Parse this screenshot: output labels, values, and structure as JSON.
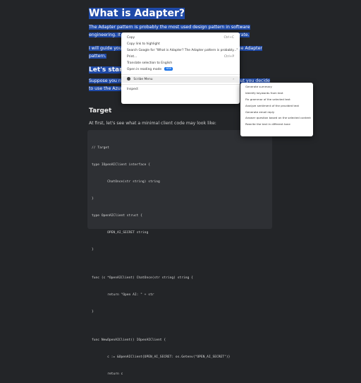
{
  "article": {
    "title": "What is Adapter?",
    "para1": "The Adapter pattern is probably the most used design pattern in software engineering. It allows objects with incompatible interfaces to collaborate.",
    "para2": "I will guide you through the example so you can better understand the Adapter pattern.",
    "heading_start": "Let's start",
    "para3": "Suppose you need to call the OpenAI client, passing the secret key. But you decide to use the Azure OpenAI client instead. How can we achieve it?",
    "heading_target": "Target",
    "para4": "At first, let's see what a minimal client code may look like:"
  },
  "code_block": {
    "lines": [
      "// Target",
      "type IOpenAIClient interface {",
      "        ChatOnce(str string) string",
      "}",
      "type OpenAIClient struct {",
      "        OPEN_AI_SECRET string",
      "}",
      "",
      "func (c *OpenAIClient) ChatOnce(str string) string {",
      "        return \"Open AI: \" + str",
      "}",
      "",
      "func NewOpenAIClient() IOpenAIClient {",
      "        c := &OpenAIClient{OPEN_AI_SECRET: os.Getenv(\"OPEN_AI_SECRET\")}",
      "        return c"
    ]
  },
  "context_menu": {
    "copy": {
      "label": "Copy",
      "shortcut": "Ctrl+C"
    },
    "copy_link": {
      "label": "Copy link to highlight"
    },
    "search_google": {
      "label": "Search Google for \"What is Adapter? The Adapter pattern is probably...\""
    },
    "print": {
      "label": "Print...",
      "shortcut": "Ctrl+P"
    },
    "translate": {
      "label": "Translate selection to English"
    },
    "reading_mode": {
      "label": "Open in reading mode",
      "badge": "NEW"
    },
    "scribe": {
      "label": "Scribe Menu",
      "arrow": "›"
    },
    "inspect": {
      "label": "Inspect"
    }
  },
  "submenu": {
    "items": [
      "Generate summary",
      "Identify keywords from text",
      "Fix grammar of the selected text",
      "Analyze sentiment of the provided text",
      "Generate email reply",
      "Answer question based on the selected content",
      "Rewrite the text in different tone"
    ]
  },
  "colors": {
    "background": "#232528",
    "selection": "#1f4aa8",
    "code_background": "#2e3034",
    "menu_background": "#ffffff"
  }
}
